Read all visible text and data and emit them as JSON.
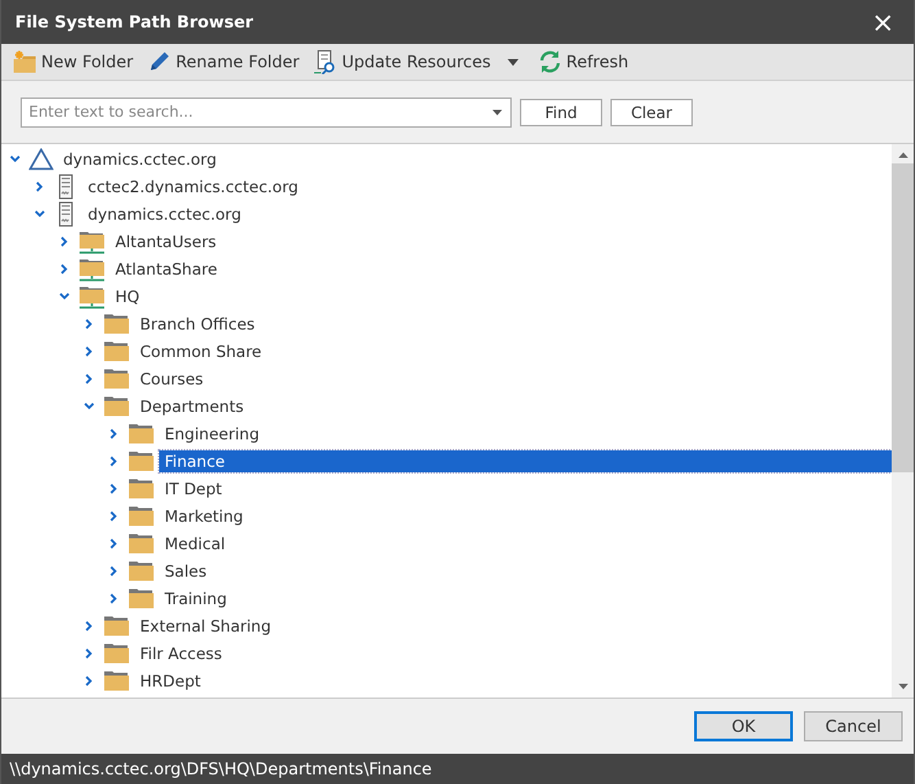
{
  "window": {
    "title": "File System Path Browser",
    "close": "×"
  },
  "toolbar": [
    {
      "kind": "new-folder",
      "label": "New Folder"
    },
    {
      "kind": "rename",
      "label": "Rename Folder"
    },
    {
      "kind": "update",
      "label": "Update Resources",
      "dropdown": true
    },
    {
      "kind": "refresh",
      "label": "Refresh"
    }
  ],
  "search": {
    "placeholder": "Enter text to search...",
    "find": "Find",
    "clear": "Clear"
  },
  "tree": [
    {
      "label": "dynamics.cctec.org",
      "kind": "domain",
      "expanded": true,
      "selected": false,
      "children": [
        {
          "label": "cctec2.dynamics.cctec.org",
          "kind": "server",
          "expanded": false,
          "selected": false
        },
        {
          "label": "dynamics.cctec.org",
          "kind": "server",
          "expanded": true,
          "selected": false,
          "children": [
            {
              "label": "AltantaUsers",
              "kind": "share",
              "expanded": false,
              "selected": false
            },
            {
              "label": "AtlantaShare",
              "kind": "share",
              "expanded": false,
              "selected": false
            },
            {
              "label": "HQ",
              "kind": "share",
              "expanded": true,
              "selected": false,
              "children": [
                {
                  "label": "Branch Offices",
                  "kind": "folder",
                  "expanded": false,
                  "selected": false
                },
                {
                  "label": "Common Share",
                  "kind": "folder",
                  "expanded": false,
                  "selected": false
                },
                {
                  "label": "Courses",
                  "kind": "folder",
                  "expanded": false,
                  "selected": false
                },
                {
                  "label": "Departments",
                  "kind": "folder",
                  "expanded": true,
                  "selected": false,
                  "children": [
                    {
                      "label": "Engineering",
                      "kind": "folder",
                      "expanded": false,
                      "selected": false
                    },
                    {
                      "label": "Finance",
                      "kind": "folder",
                      "expanded": false,
                      "selected": true
                    },
                    {
                      "label": "IT Dept",
                      "kind": "folder",
                      "expanded": false,
                      "selected": false
                    },
                    {
                      "label": "Marketing",
                      "kind": "folder",
                      "expanded": false,
                      "selected": false
                    },
                    {
                      "label": "Medical",
                      "kind": "folder",
                      "expanded": false,
                      "selected": false
                    },
                    {
                      "label": "Sales",
                      "kind": "folder",
                      "expanded": false,
                      "selected": false
                    },
                    {
                      "label": "Training",
                      "kind": "folder",
                      "expanded": false,
                      "selected": false
                    }
                  ]
                },
                {
                  "label": "External Sharing",
                  "kind": "folder",
                  "expanded": false,
                  "selected": false
                },
                {
                  "label": "Filr Access",
                  "kind": "folder",
                  "expanded": false,
                  "selected": false
                },
                {
                  "label": "HRDept",
                  "kind": "folder",
                  "expanded": false,
                  "selected": false
                }
              ]
            }
          ]
        }
      ]
    }
  ],
  "buttons": {
    "ok": "OK",
    "cancel": "Cancel"
  },
  "status_bar": "\\\\dynamics.cctec.org\\DFS\\HQ\\Departments\\Finance"
}
